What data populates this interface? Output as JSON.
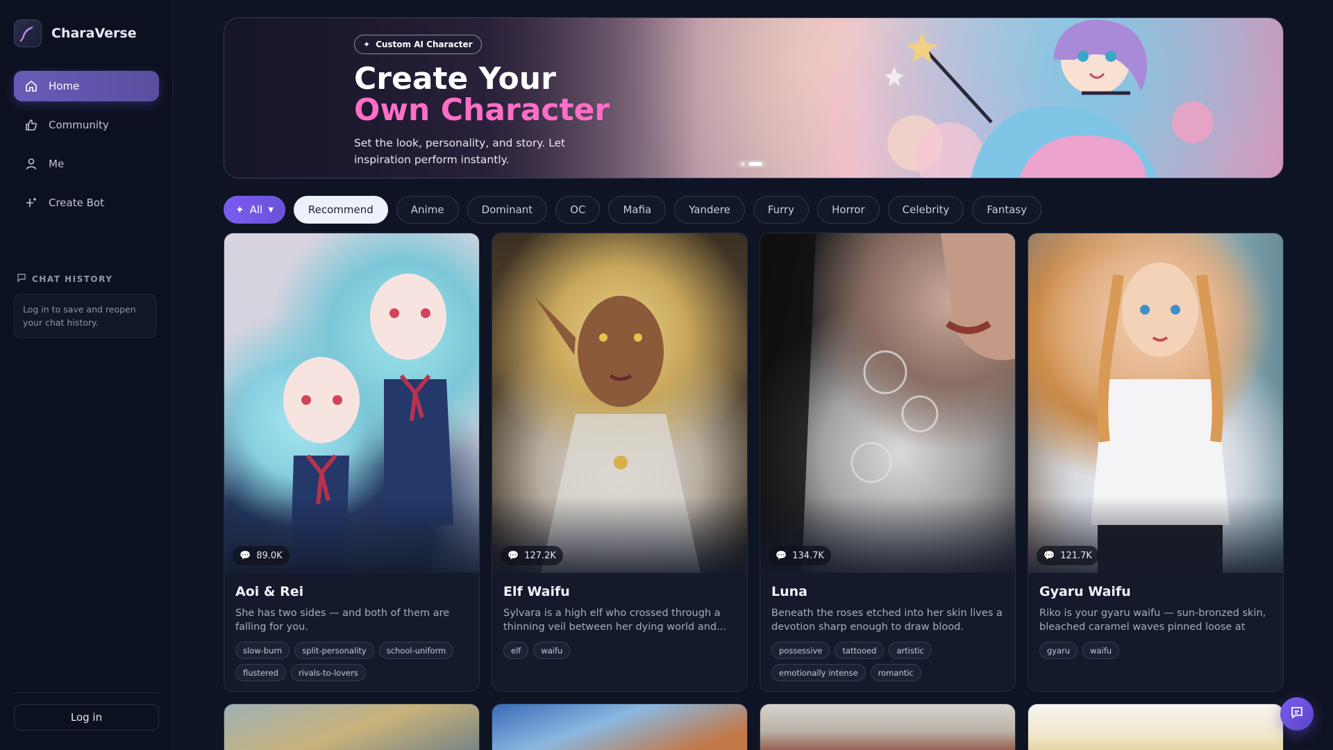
{
  "brand": {
    "name": "CharaVerse"
  },
  "nav": {
    "items": [
      {
        "label": "Home",
        "icon": "home-icon",
        "active": true
      },
      {
        "label": "Community",
        "icon": "thumbs-up-icon",
        "active": false
      },
      {
        "label": "Me",
        "icon": "user-icon",
        "active": false
      },
      {
        "label": "Create Bot",
        "icon": "sparkle-plus-icon",
        "active": false
      }
    ]
  },
  "history": {
    "title": "CHAT HISTORY",
    "empty_text": "Log in to save and reopen your chat history."
  },
  "login_label": "Log in",
  "hero": {
    "badge": "Custom AI Character",
    "title_line1": "Create Your",
    "title_line2": "Own Character",
    "subtitle": "Set the look, personality, and story. Let inspiration perform instantly.",
    "slide_count": 2,
    "active_slide": 2
  },
  "filters": {
    "all_label": "All",
    "chips": [
      "Recommend",
      "Anime",
      "Dominant",
      "OC",
      "Mafia",
      "Yandere",
      "Furry",
      "Horror",
      "Celebrity",
      "Fantasy"
    ],
    "selected": "Recommend"
  },
  "cards": [
    {
      "title": "Aoi & Rei",
      "chats": "89.0K",
      "desc": "She has two sides — and both of them are falling for you.",
      "tags": [
        "slow-burn",
        "split-personality",
        "school-uniform",
        "flustered",
        "rivals-to-lovers"
      ]
    },
    {
      "title": "Elf Waifu",
      "chats": "127.2K",
      "desc": "Sylvara is a high elf who crossed through a thinning veil between her dying world and...",
      "tags": [
        "elf",
        "waifu"
      ]
    },
    {
      "title": "Luna",
      "chats": "134.7K",
      "desc": "Beneath the roses etched into her skin lives a devotion sharp enough to draw blood.",
      "tags": [
        "possessive",
        "tattooed",
        "artistic",
        "emotionally intense",
        "romantic"
      ]
    },
    {
      "title": "Gyaru Waifu",
      "chats": "121.7K",
      "desc": "Riko is your gyaru waifu — sun-bronzed skin, bleached caramel waves pinned loose at one...",
      "tags": [
        "gyaru",
        "waifu"
      ]
    }
  ],
  "colors": {
    "accent": "#7a5cf0",
    "hero_pink": "#ff6ec7",
    "background": "#0f1424"
  }
}
